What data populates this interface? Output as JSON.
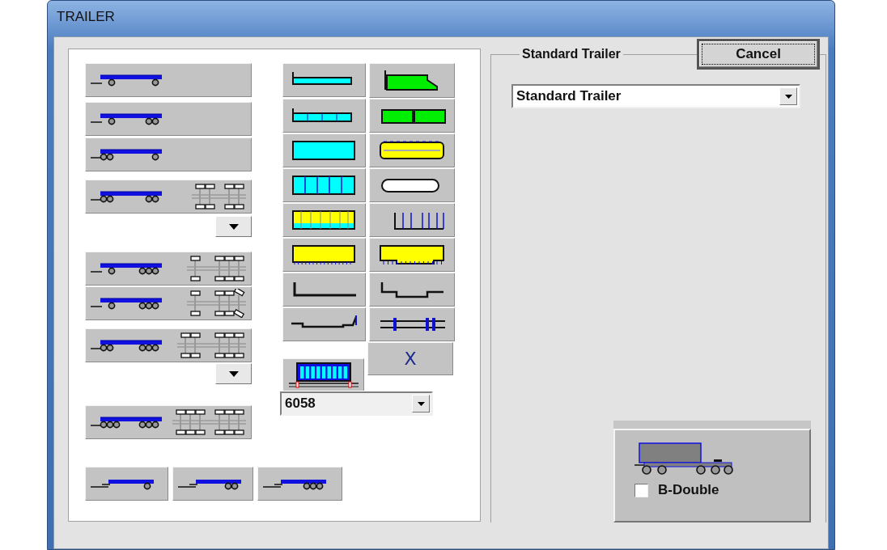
{
  "window": {
    "title": "TRAILER"
  },
  "trailer_layouts": [
    {
      "kind": "trailer"
    },
    {
      "kind": "trailer"
    },
    {
      "kind": "trailer"
    },
    {
      "kind": "trailer"
    },
    {
      "kind": "dropdown"
    },
    {
      "kind": "trailer"
    },
    {
      "kind": "trailer"
    },
    {
      "kind": "trailer"
    },
    {
      "kind": "dropdown"
    },
    {
      "kind": "trailer"
    }
  ],
  "semi_trailers": [
    {
      "kind": "semi"
    },
    {
      "kind": "semi"
    },
    {
      "kind": "semi"
    }
  ],
  "body_types": [
    {
      "kind": "tray"
    },
    {
      "kind": "tipper"
    },
    {
      "kind": "sided"
    },
    {
      "kind": "bins"
    },
    {
      "kind": "box"
    },
    {
      "kind": "tanker"
    },
    {
      "kind": "sections"
    },
    {
      "kind": "pill"
    },
    {
      "kind": "curtain"
    },
    {
      "kind": "stakes"
    },
    {
      "kind": "toothed"
    },
    {
      "kind": "dropped"
    },
    {
      "kind": "flat"
    },
    {
      "kind": "well"
    },
    {
      "kind": "lowloader"
    },
    {
      "kind": "skeletal"
    }
  ],
  "clear_button": {
    "label": "X"
  },
  "body_select": {
    "value": "6058"
  },
  "group": {
    "label": "Standard Trailer",
    "type_select": {
      "value": "Standard Trailer"
    }
  },
  "cancel_button": {
    "label": "Cancel"
  },
  "b_double": {
    "label": "B-Double",
    "checked": false
  }
}
